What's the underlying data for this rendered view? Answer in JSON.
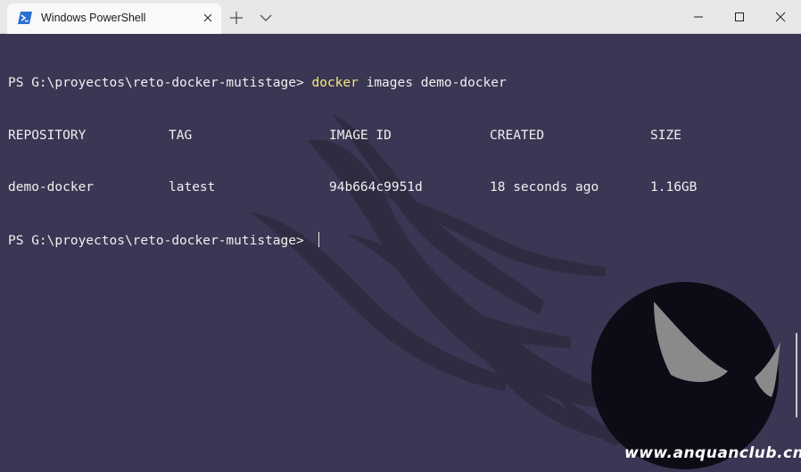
{
  "window": {
    "tab_title": "Windows PowerShell",
    "tab_icon": "powershell-icon",
    "controls": [
      "minimize-icon",
      "maximize-icon",
      "close-icon"
    ]
  },
  "terminal": {
    "line1": {
      "prompt": "PS G:\\proyectos\\reto-docker-mutistage> ",
      "command": "docker",
      "args": " images demo-docker"
    },
    "table": {
      "headers": [
        "REPOSITORY",
        "TAG",
        "IMAGE ID",
        "CREATED",
        "SIZE"
      ],
      "rows": [
        [
          "demo-docker",
          "latest",
          "94b664c9951d",
          "18 seconds ago",
          "1.16GB"
        ]
      ]
    },
    "line_last": {
      "prompt": "PS G:\\proyectos\\reto-docker-mutistage> "
    }
  },
  "watermark": "www.anquanclub.cn",
  "colors": {
    "background": "#3b3653",
    "command": "#f7e87a",
    "text": "#f0f0f0"
  }
}
